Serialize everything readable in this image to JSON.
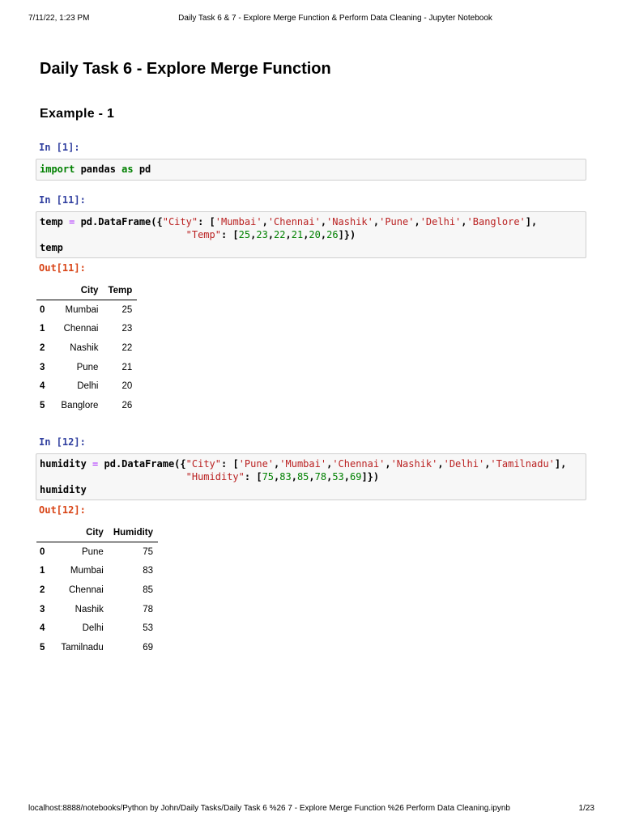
{
  "header": {
    "datetime": "7/11/22, 1:23 PM",
    "title": "Daily Task 6 & 7 - Explore Merge Function & Perform Data Cleaning - Jupyter Notebook"
  },
  "title": "Daily Task 6 - Explore Merge Function",
  "subtitle": "Example - 1",
  "cells": [
    {
      "prompt": "In [1]:",
      "code": [
        [
          [
            "kw",
            "import"
          ],
          [
            "tx",
            " pandas "
          ],
          [
            "kw",
            "as"
          ],
          [
            "tx",
            " pd"
          ]
        ]
      ]
    },
    {
      "prompt": "In [11]:",
      "out": "Out[11]:",
      "code": [
        [
          [
            "tx",
            "temp "
          ],
          [
            "op",
            "="
          ],
          [
            "tx",
            " pd.DataFrame({"
          ],
          [
            "st",
            "\"City\""
          ],
          [
            "tx",
            ": ["
          ],
          [
            "st",
            "'Mumbai'"
          ],
          [
            "tx",
            ","
          ],
          [
            "st",
            "'Chennai'"
          ],
          [
            "tx",
            ","
          ],
          [
            "st",
            "'Nashik'"
          ],
          [
            "tx",
            ","
          ],
          [
            "st",
            "'Pune'"
          ],
          [
            "tx",
            ","
          ],
          [
            "st",
            "'Delhi'"
          ],
          [
            "tx",
            ","
          ],
          [
            "st",
            "'Banglore'"
          ],
          [
            "tx",
            "],"
          ]
        ],
        [
          [
            "tx",
            "                         "
          ],
          [
            "st",
            "\"Temp\""
          ],
          [
            "tx",
            ": ["
          ],
          [
            "nm",
            "25"
          ],
          [
            "tx",
            ","
          ],
          [
            "nm",
            "23"
          ],
          [
            "tx",
            ","
          ],
          [
            "nm",
            "22"
          ],
          [
            "tx",
            ","
          ],
          [
            "nm",
            "21"
          ],
          [
            "tx",
            ","
          ],
          [
            "nm",
            "20"
          ],
          [
            "tx",
            ","
          ],
          [
            "nm",
            "26"
          ],
          [
            "tx",
            "]})"
          ]
        ],
        [
          [
            "tx",
            "temp"
          ]
        ]
      ],
      "table": {
        "columns": [
          "",
          "City",
          "Temp"
        ],
        "rows": [
          [
            "0",
            "Mumbai",
            "25"
          ],
          [
            "1",
            "Chennai",
            "23"
          ],
          [
            "2",
            "Nashik",
            "22"
          ],
          [
            "3",
            "Pune",
            "21"
          ],
          [
            "4",
            "Delhi",
            "20"
          ],
          [
            "5",
            "Banglore",
            "26"
          ]
        ]
      }
    },
    {
      "prompt": "In [12]:",
      "out": "Out[12]:",
      "code": [
        [
          [
            "tx",
            "humidity "
          ],
          [
            "op",
            "="
          ],
          [
            "tx",
            " pd.DataFrame({"
          ],
          [
            "st",
            "\"City\""
          ],
          [
            "tx",
            ": ["
          ],
          [
            "st",
            "'Pune'"
          ],
          [
            "tx",
            ","
          ],
          [
            "st",
            "'Mumbai'"
          ],
          [
            "tx",
            ","
          ],
          [
            "st",
            "'Chennai'"
          ],
          [
            "tx",
            ","
          ],
          [
            "st",
            "'Nashik'"
          ],
          [
            "tx",
            ","
          ],
          [
            "st",
            "'Delhi'"
          ],
          [
            "tx",
            ","
          ],
          [
            "st",
            "'Tamilnadu'"
          ],
          [
            "tx",
            "],"
          ]
        ],
        [
          [
            "tx",
            "                         "
          ],
          [
            "st",
            "\"Humidity\""
          ],
          [
            "tx",
            ": ["
          ],
          [
            "nm",
            "75"
          ],
          [
            "tx",
            ","
          ],
          [
            "nm",
            "83"
          ],
          [
            "tx",
            ","
          ],
          [
            "nm",
            "85"
          ],
          [
            "tx",
            ","
          ],
          [
            "nm",
            "78"
          ],
          [
            "tx",
            ","
          ],
          [
            "nm",
            "53"
          ],
          [
            "tx",
            ","
          ],
          [
            "nm",
            "69"
          ],
          [
            "tx",
            "]})"
          ]
        ],
        [
          [
            "tx",
            "humidity"
          ]
        ]
      ],
      "table": {
        "columns": [
          "",
          "City",
          "Humidity"
        ],
        "rows": [
          [
            "0",
            "Pune",
            "75"
          ],
          [
            "1",
            "Mumbai",
            "83"
          ],
          [
            "2",
            "Chennai",
            "85"
          ],
          [
            "3",
            "Nashik",
            "78"
          ],
          [
            "4",
            "Delhi",
            "53"
          ],
          [
            "5",
            "Tamilnadu",
            "69"
          ]
        ]
      }
    }
  ],
  "footer": {
    "url": "localhost:8888/notebooks/Python by John/Daily Tasks/Daily Task 6 %26 7 - Explore Merge Function %26 Perform Data Cleaning.ipynb",
    "page": "1/23"
  }
}
